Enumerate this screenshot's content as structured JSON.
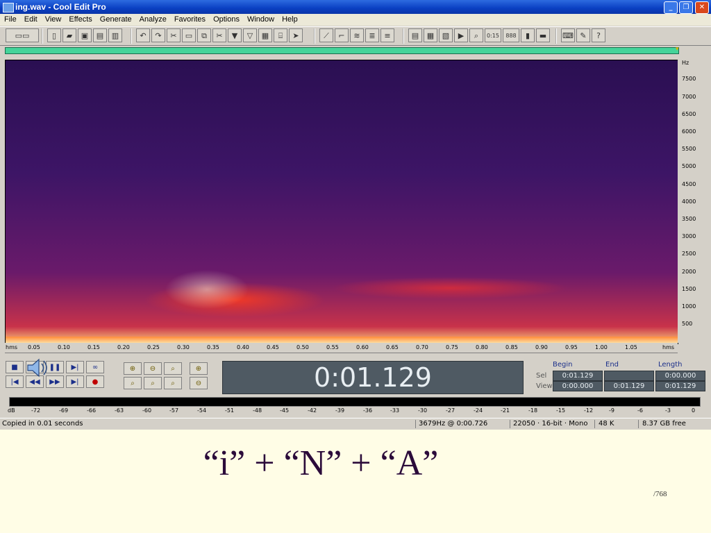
{
  "window": {
    "title": "ing.wav - Cool Edit Pro"
  },
  "menu": [
    "File",
    "Edit",
    "View",
    "Effects",
    "Generate",
    "Analyze",
    "Favorites",
    "Options",
    "Window",
    "Help"
  ],
  "freq_axis": {
    "unit": "Hz",
    "ticks": [
      "7500",
      "7000",
      "6500",
      "6000",
      "5500",
      "5000",
      "4500",
      "4000",
      "3500",
      "3000",
      "2500",
      "2000",
      "1500",
      "1000",
      "500"
    ]
  },
  "time_axis": {
    "unit": "hms",
    "ticks": [
      "0.05",
      "0.10",
      "0.15",
      "0.20",
      "0.25",
      "0.30",
      "0.35",
      "0.40",
      "0.45",
      "0.50",
      "0.55",
      "0.60",
      "0.65",
      "0.70",
      "0.75",
      "0.80",
      "0.85",
      "0.90",
      "0.95",
      "1.00",
      "1.05"
    ],
    "end_unit": "hms"
  },
  "time_display": "0:01.129",
  "selection": {
    "headers": [
      "Begin",
      "End",
      "Length"
    ],
    "sel_label": "Sel",
    "view_label": "View",
    "sel": [
      "0:01.129",
      "",
      "0:00.000"
    ],
    "view": [
      "0:00.000",
      "0:01.129",
      "0:01.129"
    ]
  },
  "meter": {
    "unit": "dB",
    "ticks": [
      "-72",
      "-69",
      "-66",
      "-63",
      "-60",
      "-57",
      "-54",
      "-51",
      "-48",
      "-45",
      "-42",
      "-39",
      "-36",
      "-33",
      "-30",
      "-27",
      "-24",
      "-21",
      "-18",
      "-15",
      "-12",
      "-9",
      "-6",
      "-3",
      "0"
    ]
  },
  "status": {
    "message": "Copied in 0.01 seconds",
    "cursor": "3679Hz @  0:00.726",
    "format": "22050 · 16-bit · Mono",
    "size": "48 K",
    "free": "8.37 GB free"
  },
  "caption": "“i” + “N” + “A”",
  "page_number": "/768"
}
